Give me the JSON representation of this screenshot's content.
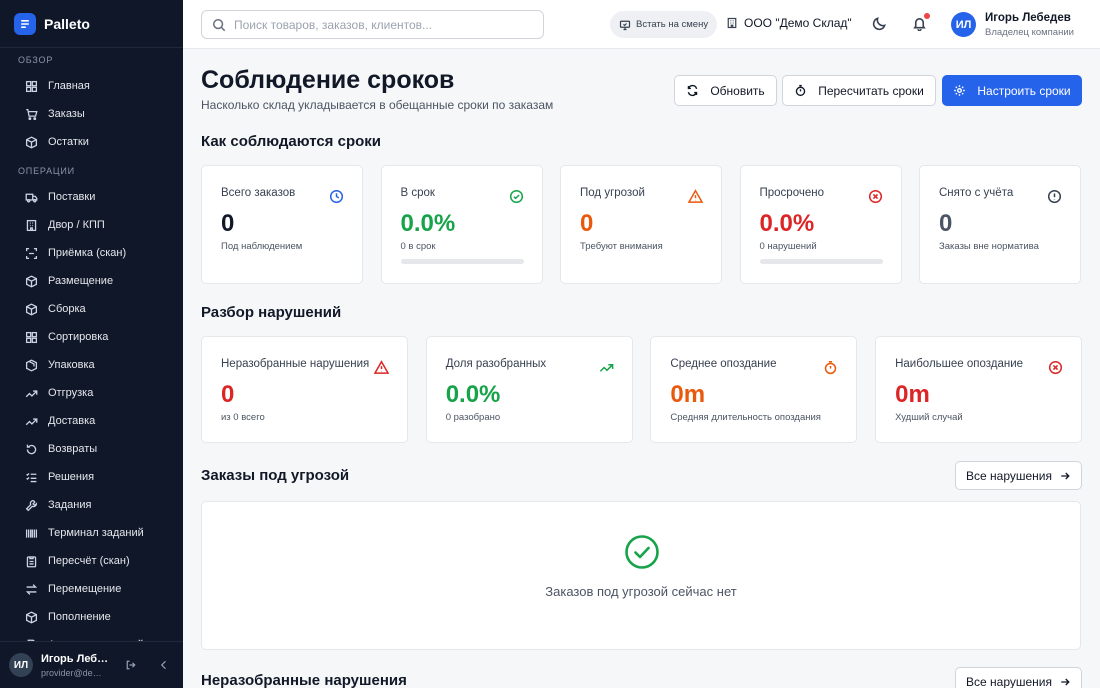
{
  "brand": {
    "name": "Palleto"
  },
  "sidebar": {
    "sections": [
      {
        "title": "ОБЗОР",
        "items": [
          {
            "label": "Главная",
            "icon": "grid-icon"
          },
          {
            "label": "Заказы",
            "icon": "cart-icon"
          },
          {
            "label": "Остатки",
            "icon": "box-icon"
          }
        ]
      },
      {
        "title": "ОПЕРАЦИИ",
        "items": [
          {
            "label": "Поставки",
            "icon": "truck-icon"
          },
          {
            "label": "Двор / КПП",
            "icon": "building-icon"
          },
          {
            "label": "Приёмка (скан)",
            "icon": "scan-icon"
          },
          {
            "label": "Размещение",
            "icon": "box-icon"
          },
          {
            "label": "Сборка",
            "icon": "box-icon"
          },
          {
            "label": "Сортировка",
            "icon": "grid-icon"
          },
          {
            "label": "Упаковка",
            "icon": "package-icon"
          },
          {
            "label": "Отгрузка",
            "icon": "trend-icon"
          },
          {
            "label": "Доставка",
            "icon": "trend-icon"
          },
          {
            "label": "Возвраты",
            "icon": "return-icon"
          },
          {
            "label": "Решения",
            "icon": "checklist-icon"
          },
          {
            "label": "Задания",
            "icon": "wrench-icon"
          },
          {
            "label": "Терминал заданий",
            "icon": "barcode-icon"
          },
          {
            "label": "Пересчёт (скан)",
            "icon": "clipboard-icon"
          },
          {
            "label": "Перемещение",
            "icon": "arrows-icon"
          },
          {
            "label": "Пополнение",
            "icon": "box-icon"
          },
          {
            "label": "Акты расхождений",
            "icon": "document-icon"
          }
        ]
      }
    ],
    "footer": {
      "initials": "ИЛ",
      "name": "Игорь Лебедев",
      "email": "provider@demo.palleto.ru"
    }
  },
  "header": {
    "search_placeholder": "Поиск товаров, заказов, клиентов...",
    "shift_button": "Встать на смену",
    "company": "ООО \"Демо Склад\"",
    "user": {
      "initials": "ИЛ",
      "name": "Игорь Лебедев",
      "role": "Владелец компании"
    }
  },
  "page": {
    "title": "Соблюдение сроков",
    "subtitle": "Насколько склад укладывается в обещанные сроки по заказам",
    "actions": {
      "refresh": "Обновить",
      "recalc": "Пересчитать сроки",
      "configure": "Настроить сроки"
    }
  },
  "compliance": {
    "title": "Как соблюдаются сроки",
    "cards": [
      {
        "label": "Всего заказов",
        "value": "0",
        "note": "Под наблюдением",
        "icon": "clock-icon",
        "color": "#111827",
        "icon_color": "#2563eb"
      },
      {
        "label": "В срок",
        "value": "0.0%",
        "note": "0 в срок",
        "icon": "check-circle-icon",
        "color": "#16a34a",
        "icon_color": "#16a34a",
        "progress": 0
      },
      {
        "label": "Под угрозой",
        "value": "0",
        "note": "Требуют внимания",
        "icon": "warning-icon",
        "color": "#ea580c",
        "icon_color": "#ea580c"
      },
      {
        "label": "Просрочено",
        "value": "0.0%",
        "note": "0 нарушений",
        "icon": "x-circle-icon",
        "color": "#dc2626",
        "icon_color": "#dc2626",
        "progress": 0
      },
      {
        "label": "Снято с учёта",
        "value": "0",
        "note": "Заказы вне норматива",
        "icon": "info-circle-icon",
        "color": "#4b5563",
        "icon_color": "#374151"
      }
    ]
  },
  "violations": {
    "title": "Разбор нарушений",
    "cards": [
      {
        "label": "Неразобранные нарушения",
        "value": "0",
        "note": "из 0 всего",
        "icon": "warning-icon",
        "color": "#dc2626",
        "icon_color": "#dc2626"
      },
      {
        "label": "Доля разобранных",
        "value": "0.0%",
        "note": "0 разобрано",
        "icon": "trend-up-icon",
        "color": "#16a34a",
        "icon_color": "#16a34a"
      },
      {
        "label": "Среднее опоздание",
        "value": "0m",
        "note": "Средняя длительность опоздания",
        "icon": "timer-icon",
        "color": "#ea580c",
        "icon_color": "#ea580c"
      },
      {
        "label": "Наибольшее опоздание",
        "value": "0m",
        "note": "Худший случай",
        "icon": "x-circle-icon",
        "color": "#dc2626",
        "icon_color": "#dc2626"
      }
    ]
  },
  "at_risk": {
    "title": "Заказы под угрозой",
    "link": "Все нарушения",
    "empty_text": "Заказов под угрозой сейчас нет"
  },
  "unresolved": {
    "title": "Неразобранные нарушения",
    "link": "Все нарушения"
  }
}
